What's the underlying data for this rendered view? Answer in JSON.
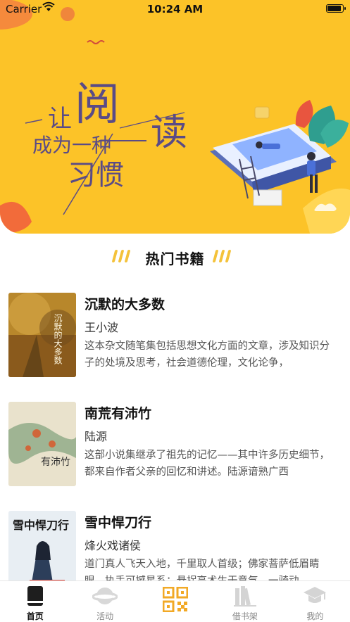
{
  "status_bar": {
    "carrier": "Carrier",
    "time": "10:24 AM",
    "battery_level": 0.95
  },
  "banner": {
    "slogan_line1": "让阅读",
    "slogan_line2": "成为一种",
    "slogan_line3": "习惯",
    "colors": {
      "background": "#fcc328",
      "ink": "#5a4b86"
    }
  },
  "section": {
    "title": "热门书籍"
  },
  "books": [
    {
      "title": "沉默的大多数",
      "author": "王小波",
      "description": "这本杂文随笔集包括思想文化方面的文章，涉及知识分子的处境及思考，社会道德伦理，文化论争，",
      "cover_text": "沉默的大多数"
    },
    {
      "title": "南荒有沛竹",
      "author": "陆源",
      "description": "这部小说集继承了祖先的记忆——其中许多历史细节，都来自作者父亲的回忆和讲述。陆源谙熟广西",
      "cover_text": "有沛竹"
    },
    {
      "title": "雪中悍刀行",
      "author": "烽火戏诸侯",
      "description": "道门真人飞天入地，千里取人首级；佛家菩萨低眉睛眼，执手可撼星系；悬拐高术生于意气，一骑动",
      "cover_text": "雪中悍刀行"
    }
  ],
  "tabs": [
    {
      "label": "首页",
      "icon": "book-icon",
      "active": true
    },
    {
      "label": "活动",
      "icon": "planet-icon",
      "active": false
    },
    {
      "label": "",
      "icon": "qr-code-icon",
      "active": false
    },
    {
      "label": "借书架",
      "icon": "bookshelf-icon",
      "active": false
    },
    {
      "label": "我的",
      "icon": "graduation-cap-icon",
      "active": false
    }
  ],
  "accent_color": "#fcc328"
}
